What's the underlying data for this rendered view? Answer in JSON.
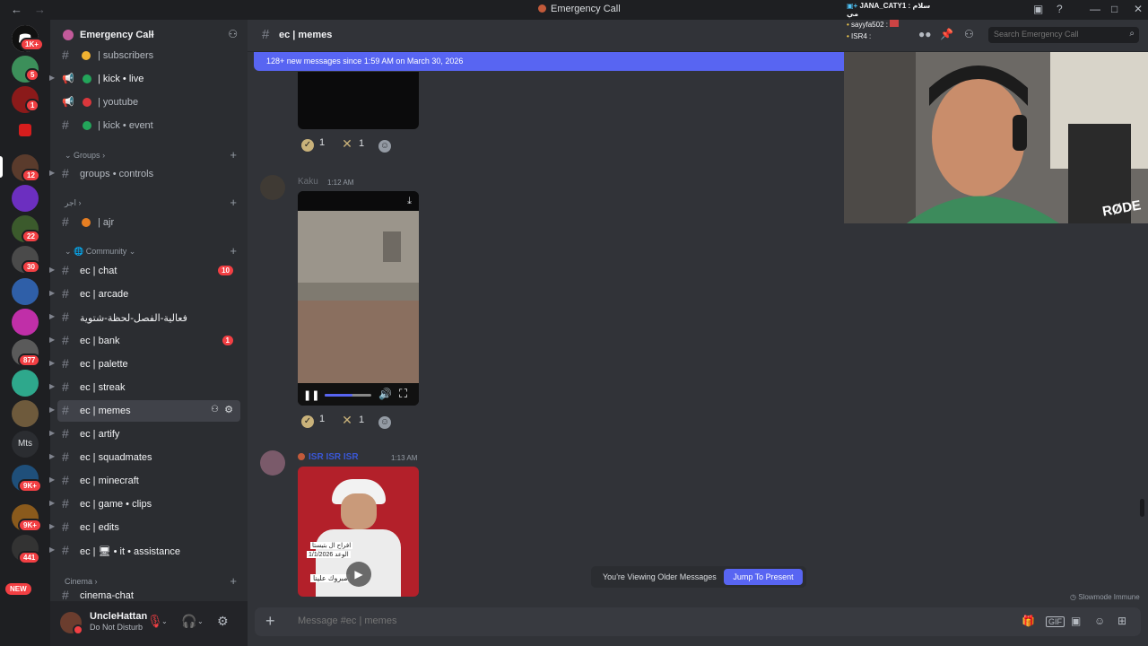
{
  "window": {
    "title": "Emergency Call"
  },
  "servers": {
    "badges": [
      "1K+",
      "5",
      "1",
      "12",
      "22",
      "30",
      "877",
      "9K+",
      "9K+",
      "441"
    ],
    "text_server": "Mts",
    "new_label": "NEW"
  },
  "server": {
    "name": "Emergency Call"
  },
  "channels": {
    "top": [
      {
        "label": "| subscribers"
      },
      {
        "label": "| kick • live"
      },
      {
        "label": "| youtube"
      },
      {
        "label": "| kick • event"
      }
    ],
    "cat_groups": "Groups",
    "groups_controls": "groups • controls",
    "cat_arabic": "اجر",
    "ajr": "| ajr",
    "cat_community": "Community",
    "community": [
      {
        "label": "ec | chat",
        "badge": "10"
      },
      {
        "label": "ec | arcade"
      },
      {
        "label": "فعالية-الفصل-لحظة-شتوية"
      },
      {
        "label": "ec | bank",
        "badge": "1"
      },
      {
        "label": "ec | palette"
      },
      {
        "label": "ec | streak"
      },
      {
        "label": "ec | memes"
      },
      {
        "label": "ec | artify"
      },
      {
        "label": "ec | squadmates"
      },
      {
        "label": "ec | minecraft"
      },
      {
        "label": "ec | game • clips"
      },
      {
        "label": "ec | edits"
      },
      {
        "label": "ec | 🖥 • it • assistance"
      }
    ],
    "cat_cinema": "Cinema",
    "cinema_chat": "cinema-chat"
  },
  "user": {
    "name": "UncleHattan",
    "status": "Do Not Disturb"
  },
  "header": {
    "channel_title": "ec | memes",
    "search_placeholder": "Search Emergency Call"
  },
  "banner": {
    "new_messages": "128+ new messages since 1:59 AM on March 30, 2026"
  },
  "messages": {
    "m0_reactions": {
      "check": "1",
      "x": "1"
    },
    "m1": {
      "author": "Kaku",
      "time": "1:12 AM",
      "reactions": {
        "check": "1",
        "x": "1"
      }
    },
    "m2": {
      "author": "ISR ISR ISR",
      "time": "1:13 AM",
      "caption_1": "افراح ال بتيستا",
      "caption_2": "الوعد 1/1/2026",
      "caption_3": "مبروك علينا"
    }
  },
  "overlay": {
    "line1": "JANA_CATY1 : سلام مي",
    "line2": "sayyfa502 :",
    "line3": "ISR4 :",
    "logo": "RØDE"
  },
  "bottom": {
    "older_text": "You're Viewing Older Messages",
    "jump_label": "Jump To Present",
    "slowmode": "Slowmode Immune",
    "composer_placeholder": "Message #ec | memes"
  },
  "colors": {
    "accent": "#5865f2",
    "danger": "#f23f43",
    "sidebar": "#2b2d31",
    "main": "#313338"
  }
}
